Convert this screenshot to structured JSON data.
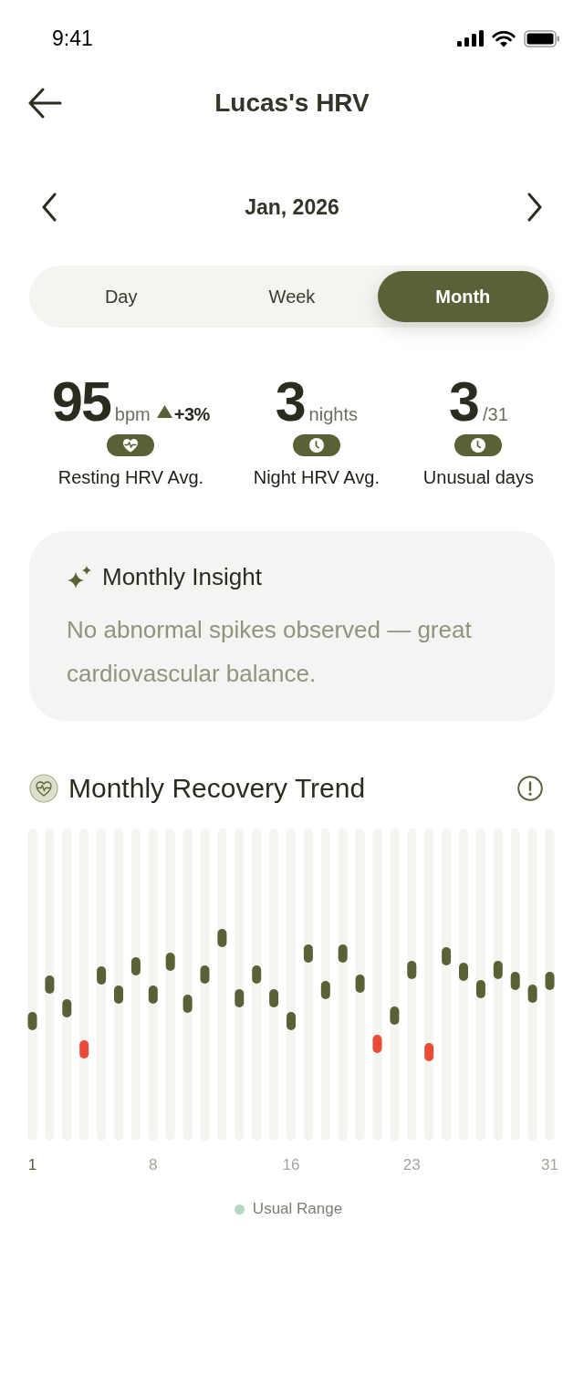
{
  "status_bar": {
    "time": "9:41"
  },
  "header": {
    "title": "Lucas's HRV"
  },
  "period_nav": {
    "label": "Jan, 2026"
  },
  "tabs": [
    {
      "label": "Day",
      "selected": false
    },
    {
      "label": "Week",
      "selected": false
    },
    {
      "label": "Month",
      "selected": true
    }
  ],
  "stats": [
    {
      "value": "95",
      "unit": "bpm",
      "rising": true,
      "change": "+3%",
      "label": "Resting HRV Avg."
    },
    {
      "value": "3",
      "unit": "nights",
      "label": "Night HRV Avg."
    },
    {
      "value": "3",
      "unit": "/31",
      "label": "Unusual days"
    }
  ],
  "insight": {
    "title": "Monthly Insight",
    "text": "No abnormal spikes observed — great cardiovascular balance."
  },
  "chart": {
    "title": "Monthly Recovery Trend",
    "days": [
      {
        "unusual": false
      },
      {
        "unusual": false
      },
      {
        "unusual": false
      },
      {
        "unusual": true
      },
      {
        "unusual": false
      },
      {
        "unusual": false
      },
      {
        "unusual": false
      },
      {
        "unusual": false
      },
      {
        "unusual": false
      },
      {
        "unusual": false
      },
      {
        "unusual": false
      },
      {
        "unusual": false
      },
      {
        "unusual": false
      },
      {
        "unusual": false
      },
      {
        "unusual": false
      },
      {
        "unusual": false
      },
      {
        "unusual": false
      },
      {
        "unusual": false
      },
      {
        "unusual": false
      },
      {
        "unusual": false
      },
      {
        "unusual": true
      },
      {
        "unusual": false
      },
      {
        "unusual": false
      },
      {
        "unusual": true
      },
      {
        "unusual": false
      },
      {
        "unusual": false
      },
      {
        "unusual": false
      },
      {
        "unusual": false
      },
      {
        "unusual": false
      },
      {
        "unusual": false
      },
      {
        "unusual": false
      }
    ],
    "x_labels": [
      {
        "text": "1",
        "selected": true
      },
      {
        "text": "8",
        "selected": false
      },
      {
        "text": "16",
        "selected": false
      },
      {
        "text": "23",
        "selected": false
      },
      {
        "text": "31",
        "selected": false
      }
    ],
    "legend": [
      {
        "label": "Usual Range"
      }
    ]
  }
}
